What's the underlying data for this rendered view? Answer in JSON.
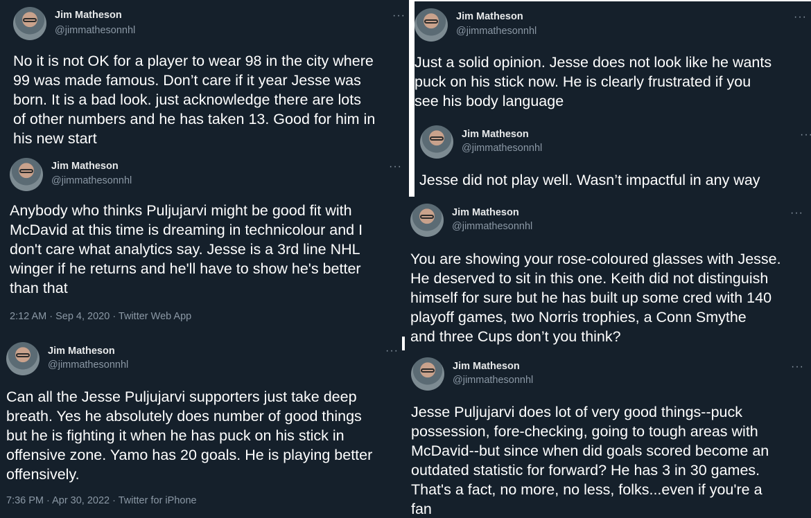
{
  "tweets": [
    {
      "author_name": "Jim Matheson",
      "author_handle": "@jimmathesonnhl",
      "more": "···",
      "text": "No it is not OK for a player to wear 98 in the city where\n99 was made famous. Don’t care if it year Jesse was\nborn. It is a bad look. just acknowledge there are lots\nof other numbers and he has taken 13. Good for him in\nhis new start"
    },
    {
      "author_name": "Jim Matheson",
      "author_handle": "@jimmathesonnhl",
      "more": "···",
      "text": "Anybody who thinks Puljujarvi might be good fit with\nMcDavid at this time is dreaming in technicolour and I\ndon't care what analytics say. Jesse is a 3rd line NHL\nwinger if he returns and he'll have to show he's better\nthan that",
      "meta": "2:12 AM · Sep 4, 2020 · Twitter Web App"
    },
    {
      "author_name": "Jim Matheson",
      "author_handle": "@jimmathesonnhl",
      "more": "···",
      "text": "Can all the Jesse Puljujarvi supporters just take deep\nbreath. Yes he absolutely does number of good things\nbut he is fighting it when he has puck on his stick in\noffensive zone. Yamo has 20 goals. He is playing better\noffensively.",
      "meta": "7:36 PM · Apr 30, 2022 · Twitter for iPhone"
    },
    {
      "author_name": "Jim Matheson",
      "author_handle": "@jimmathesonnhl",
      "more": "···",
      "text": "Just a solid opinion. Jesse does not look like he wants\npuck on his stick now. He is clearly frustrated if you\nsee his body language"
    },
    {
      "author_name": "Jim Matheson",
      "author_handle": "@jimmathesonnhl",
      "more": "···",
      "text": "Jesse did not play well. Wasn’t impactful in any way"
    },
    {
      "author_name": "Jim Matheson",
      "author_handle": "@jimmathesonnhl",
      "more": "···",
      "text": "You are showing your rose-coloured glasses with Jesse.\nHe deserved to sit in this one. Keith did not distinguish\nhimself for sure but he has built up some cred with 140\nplayoff games, two Norris trophies, a Conn Smythe\nand three Cups don’t you think?"
    },
    {
      "author_name": "Jim Matheson",
      "author_handle": "@jimmathesonnhl",
      "more": "···",
      "text": "Jesse Puljujarvi does lot of very good things--puck\npossession, fore-checking, going to tough areas with\nMcDavid--but since when did goals scored become an\noutdated statistic for forward? He has 3 in 30 games.\nThat's a fact, no more, no less, folks...even if you're a\nfan"
    }
  ]
}
